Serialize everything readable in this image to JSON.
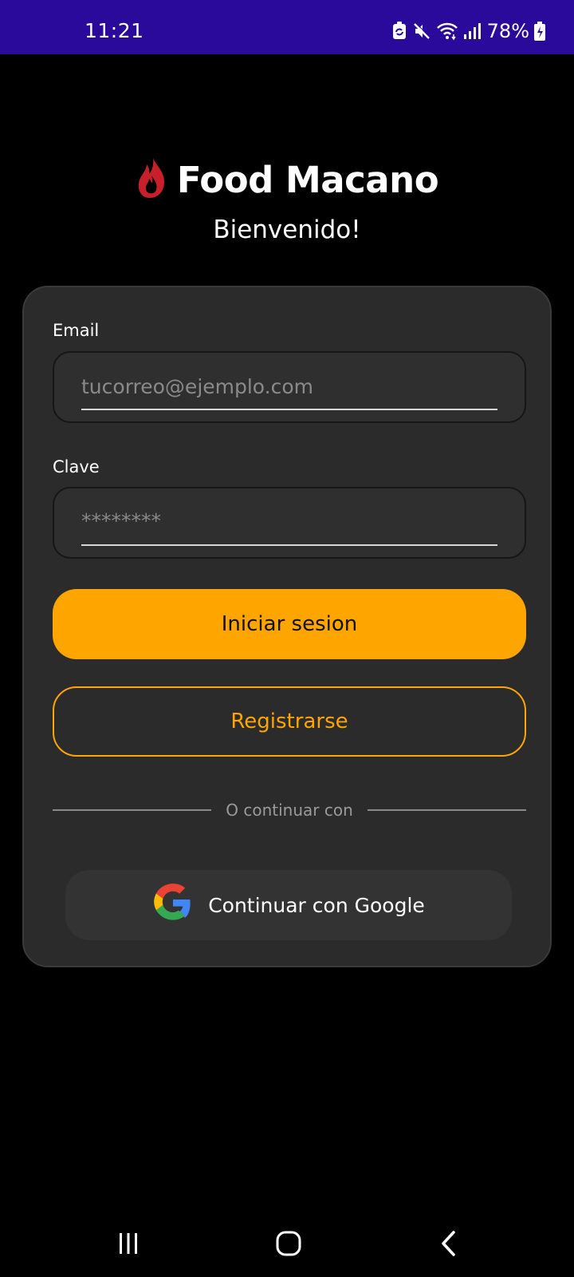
{
  "status_bar": {
    "time": "11:21",
    "battery": "78%",
    "background_color": "#2a0a9b",
    "icons": [
      "sync-icon",
      "mute-icon",
      "wifi-icon",
      "signal-icon",
      "battery-charging-icon"
    ]
  },
  "header": {
    "app_name": "Food Macano",
    "logo_icon": "flame-logo-icon",
    "logo_color": "#c8202a",
    "welcome": "Bienvenido!"
  },
  "login_form": {
    "email_label": "Email",
    "email_placeholder": "tucorreo@ejemplo.com",
    "password_label": "Clave",
    "password_placeholder": "********",
    "login_button": "Iniciar sesion",
    "register_button": "Registrarse",
    "divider_text": "O continuar con",
    "google_button": "Continuar con Google",
    "google_icon": "google-icon",
    "accent_color": "#ffa500"
  },
  "nav_bar": {
    "icons": [
      "recent-apps-icon",
      "home-icon",
      "back-icon"
    ]
  }
}
